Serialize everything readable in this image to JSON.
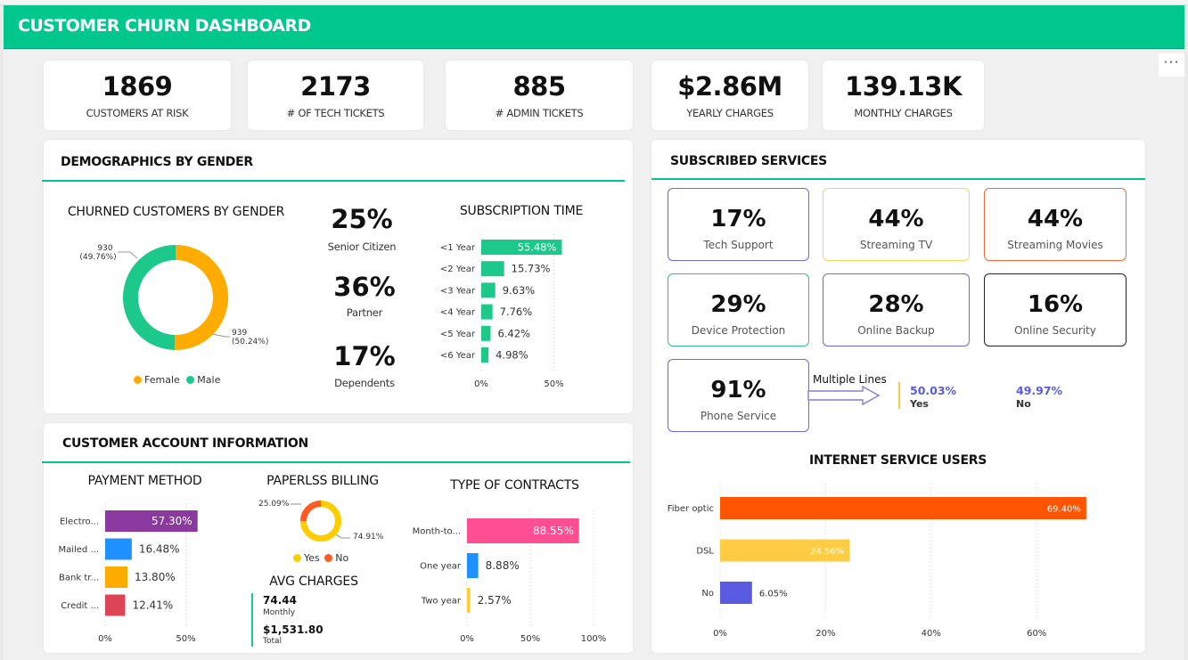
{
  "header": {
    "title": "CUSTOMER CHURN DASHBOARD",
    "more": "···"
  },
  "kpis": [
    {
      "value": "1869",
      "label": "CUSTOMERS AT RISK"
    },
    {
      "value": "2173",
      "label": "# OF TECH TICKETS"
    },
    {
      "value": "885",
      "label": "# ADMIN TICKETS"
    },
    {
      "value": "$2.86M",
      "label": "YEARLY CHARGES"
    },
    {
      "value": "139.13K",
      "label": "MONTHLY CHARGES"
    }
  ],
  "demographics": {
    "title": "DEMOGRAPHICS BY GENDER",
    "gender_title": "CHURNED CUSTOMERS BY GENDER",
    "male_label_count": "930",
    "male_label_pct": "(49.76%)",
    "female_label_count": "939",
    "female_label_pct": "(50.24%)",
    "legend_female": "Female",
    "legend_male": "Male",
    "senior_value": "25%",
    "senior_label": "Senior Citizen",
    "partner_value": "36%",
    "partner_label": "Partner",
    "dependents_value": "17%",
    "dependents_label": "Dependents",
    "sub_title": "SUBSCRIPTION TIME",
    "sub_ticks": [
      "0%",
      "50%"
    ]
  },
  "services": {
    "title": "SUBSCRIBED SERVICES",
    "tiles": [
      {
        "value": "17%",
        "label": "Tech Support",
        "color": "#6f68d6"
      },
      {
        "value": "44%",
        "label": "Streaming TV",
        "color": "#f7d55e"
      },
      {
        "value": "44%",
        "label": "Streaming Movies",
        "color": "#ee6a3c"
      },
      {
        "value": "29%",
        "label": "Device Protection",
        "color": "#2fc28f"
      },
      {
        "value": "28%",
        "label": "Online Backup",
        "color": "#6f68d6"
      },
      {
        "value": "16%",
        "label": "Online Security",
        "color": "#222222"
      },
      {
        "value": "91%",
        "label": "Phone Service",
        "color": "#6f68d6"
      }
    ],
    "multiple_lines_label": "Multiple Lines",
    "ml_yes_value": "50.03%",
    "ml_yes_label": "Yes",
    "ml_no_value": "49.97%",
    "ml_no_label": "No",
    "internet_title": "INTERNET SERVICE USERS",
    "internet_ticks": [
      "0%",
      "20%",
      "40%",
      "60%"
    ]
  },
  "account": {
    "title": "CUSTOMER ACCOUNT INFORMATION",
    "payment_title": "PAYMENT METHOD",
    "payment_ticks": [
      "0%",
      "50%"
    ],
    "paperless_title": "PAPERLSS BILLING",
    "paperless_no_label": "25.09%",
    "paperless_yes_label": "74.91%",
    "legend_yes": "Yes",
    "legend_no": "No",
    "avg_title": "AVG CHARGES",
    "avg_monthly_value": "74.44",
    "avg_monthly_label": "Monthly",
    "avg_total_value": "$1,531.80",
    "avg_total_label": "Total",
    "contracts_title": "TYPE OF CONTRACTS",
    "contract_ticks": [
      "0%",
      "50%",
      "100%"
    ]
  },
  "chart_data": [
    {
      "type": "pie",
      "title": "CHURNED CUSTOMERS BY GENDER",
      "categories": [
        "Female",
        "Male"
      ],
      "values": [
        939,
        930
      ],
      "percentages": [
        50.24,
        49.76
      ],
      "colors": [
        "#ffab00",
        "#1dc98a"
      ],
      "legend": "bottom"
    },
    {
      "type": "bar",
      "title": "SUBSCRIPTION TIME",
      "orientation": "horizontal",
      "categories": [
        "<1 Year",
        "<2 Year",
        "<3 Year",
        "<4 Year",
        "<5 Year",
        "<6 Year"
      ],
      "values": [
        55.48,
        15.73,
        9.63,
        7.76,
        6.42,
        4.98
      ],
      "labels": [
        "55.48%",
        "15.73%",
        "9.63%",
        "7.76%",
        "6.42%",
        "4.98%"
      ],
      "color": "#1dc98a",
      "xlim": [
        0,
        50
      ]
    },
    {
      "type": "bar",
      "title": "PAYMENT METHOD",
      "orientation": "horizontal",
      "categories": [
        "Electro...",
        "Mailed ...",
        "Bank tr...",
        "Credit ..."
      ],
      "values": [
        57.3,
        16.48,
        13.8,
        12.41
      ],
      "labels": [
        "57.30%",
        "16.48%",
        "13.80%",
        "12.41%"
      ],
      "colors": [
        "#8a3a9e",
        "#1e90ff",
        "#ffab00",
        "#dd4455"
      ],
      "xlim": [
        0,
        50
      ]
    },
    {
      "type": "pie",
      "title": "PAPERLSS BILLING",
      "categories": [
        "Yes",
        "No"
      ],
      "values": [
        74.91,
        25.09
      ],
      "colors": [
        "#ffcc00",
        "#ff5a1f"
      ],
      "legend": "bottom"
    },
    {
      "type": "bar",
      "title": "TYPE OF CONTRACTS",
      "orientation": "horizontal",
      "categories": [
        "Month-to...",
        "One year",
        "Two year"
      ],
      "values": [
        88.55,
        8.88,
        2.57
      ],
      "labels": [
        "88.55%",
        "8.88%",
        "2.57%"
      ],
      "colors": [
        "#ff4f92",
        "#1e90ff",
        "#ffcc33"
      ],
      "xlim": [
        0,
        100
      ]
    },
    {
      "type": "bar",
      "title": "INTERNET SERVICE USERS",
      "orientation": "horizontal",
      "categories": [
        "Fiber optic",
        "DSL",
        "No"
      ],
      "values": [
        69.4,
        24.56,
        6.05
      ],
      "labels": [
        "69.40%",
        "24.56%",
        "6.05%"
      ],
      "colors": [
        "#ff5500",
        "#ffcc44",
        "#5a5ae0"
      ],
      "xlim": [
        0,
        60
      ]
    }
  ]
}
